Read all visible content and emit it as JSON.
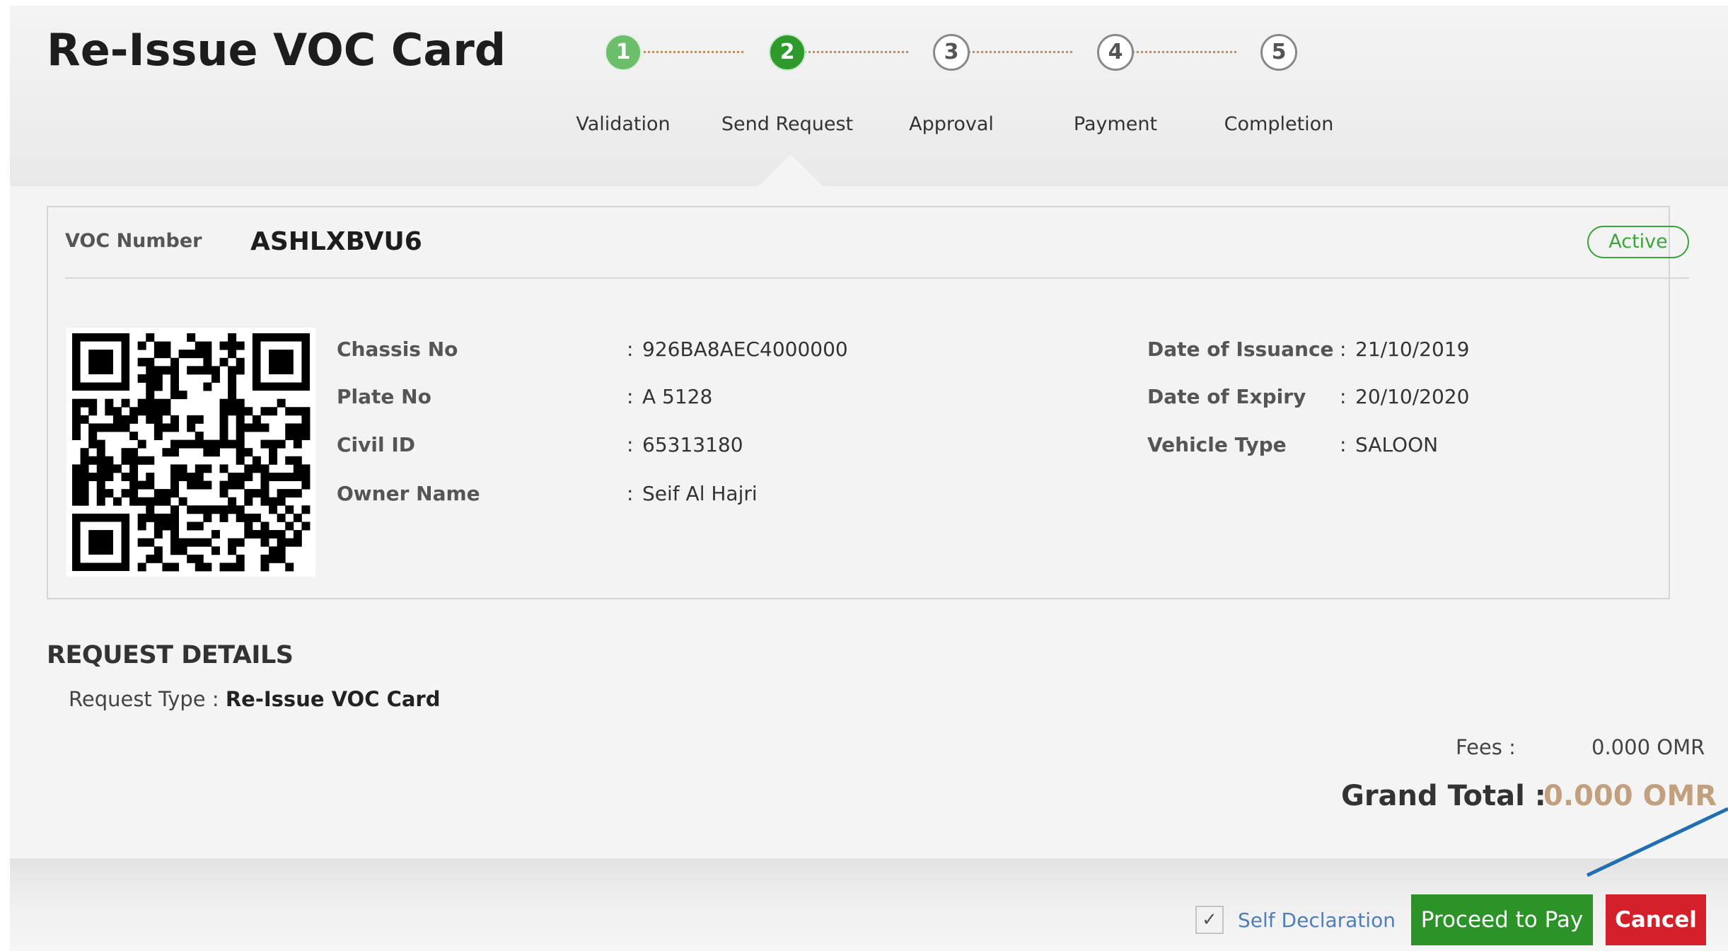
{
  "page": {
    "title": "Re-Issue VOC Card"
  },
  "stepper": {
    "steps": [
      {
        "number": "1",
        "label": "Validation",
        "state": "done"
      },
      {
        "number": "2",
        "label": "Send Request",
        "state": "current"
      },
      {
        "number": "3",
        "label": "Approval",
        "state": "todo"
      },
      {
        "number": "4",
        "label": "Payment",
        "state": "todo"
      },
      {
        "number": "5",
        "label": "Completion",
        "state": "todo"
      }
    ]
  },
  "card": {
    "voc_label": "VOC Number",
    "voc_number": "ASHLXBVU6",
    "status": "Active",
    "left_fields": [
      {
        "label": "Chassis No",
        "value": "926BA8AEC4000000"
      },
      {
        "label": "Plate No",
        "value": "A 5128"
      },
      {
        "label": "Civil ID",
        "value": "65313180"
      },
      {
        "label": "Owner Name",
        "value": "Seif Al Hajri"
      }
    ],
    "right_fields": [
      {
        "label": "Date of Issuance",
        "value": "21/10/2019"
      },
      {
        "label": "Date of Expiry",
        "value": "20/10/2020"
      },
      {
        "label": "Vehicle Type",
        "value": "SALOON"
      }
    ]
  },
  "request": {
    "heading": "REQUEST DETAILS",
    "type_label": "Request Type :",
    "type_value": "Re-Issue VOC Card",
    "fees_label": "Fees :",
    "fees_value": "0.000 OMR",
    "grand_total_label": "Grand Total :",
    "grand_total_value": "0.000 OMR"
  },
  "footer": {
    "self_declaration_label": "Self Declaration",
    "self_declaration_checked": true,
    "proceed_label": "Proceed to Pay",
    "cancel_label": "Cancel"
  },
  "colors": {
    "step_done": "#6cbf6a",
    "step_current": "#2e9a2b",
    "status_active": "#3aa53a",
    "grand_total": "#c2a07e",
    "proceed_button": "#2b9327",
    "cancel_button": "#d4202a",
    "link_blue": "#4e7fb8",
    "annotation_arrow": "#1f6fb2"
  }
}
